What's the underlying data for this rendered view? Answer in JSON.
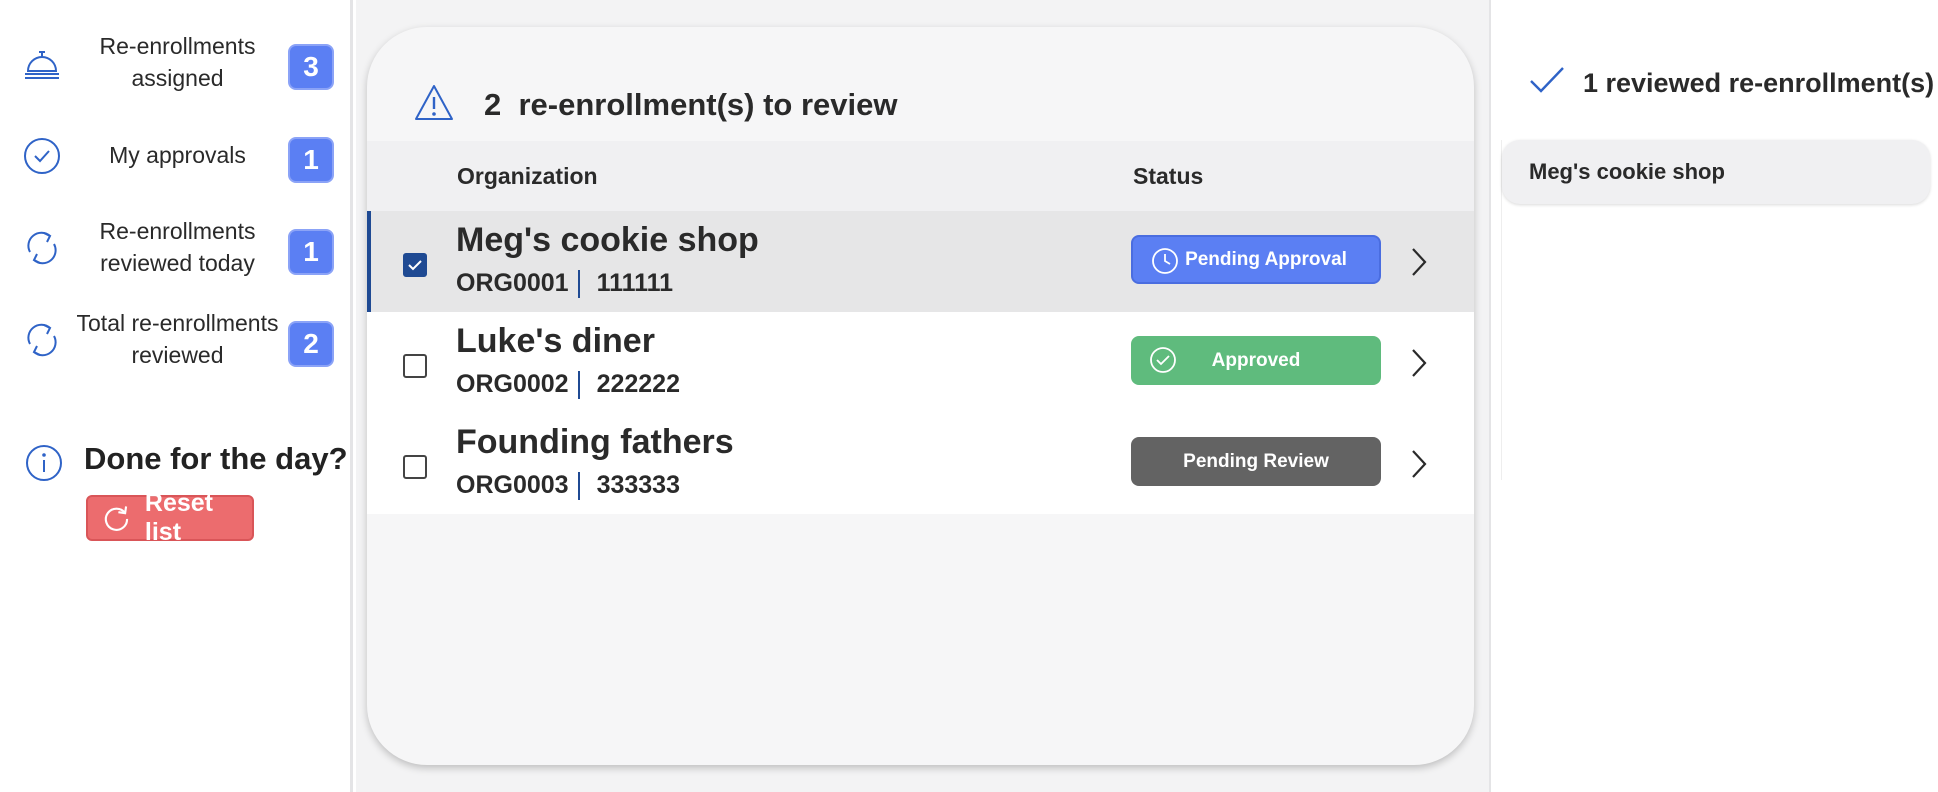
{
  "sidebar": {
    "stats": [
      {
        "icon": "service-bell-icon",
        "label": "Re-enrollments assigned",
        "count": "3"
      },
      {
        "icon": "check-circle-icon",
        "label": "My approvals",
        "count": "1"
      },
      {
        "icon": "refresh-icon",
        "label": "Re-enrollments reviewed today",
        "count": "1"
      },
      {
        "icon": "refresh-icon",
        "label": "Total re-enrollments reviewed",
        "count": "2"
      }
    ],
    "done_title": "Done for the day?",
    "reset_label": "Reset list"
  },
  "review": {
    "count": "2",
    "title_suffix": "re-enrollment(s) to review",
    "col_org": "Organization",
    "col_status": "Status",
    "rows": [
      {
        "name": "Meg's cookie shop",
        "org_id": "ORG0001",
        "number": "111111",
        "status": "Pending Approval",
        "status_type": "pending-approval",
        "checked": true
      },
      {
        "name": "Luke's diner",
        "org_id": "ORG0002",
        "number": "222222",
        "status": "Approved",
        "status_type": "approved",
        "checked": false
      },
      {
        "name": "Founding fathers",
        "org_id": "ORG0003",
        "number": "333333",
        "status": "Pending Review",
        "status_type": "pending-review",
        "checked": false
      }
    ]
  },
  "reviewed": {
    "title": "1 reviewed re-enrollment(s)",
    "items": [
      "Meg's cookie shop"
    ]
  },
  "colors": {
    "accent_blue": "#5b7ff3",
    "navy": "#1f4a93",
    "approved_green": "#5fbb7d",
    "review_gray": "#636363",
    "reset_red": "#ec6c6e"
  }
}
